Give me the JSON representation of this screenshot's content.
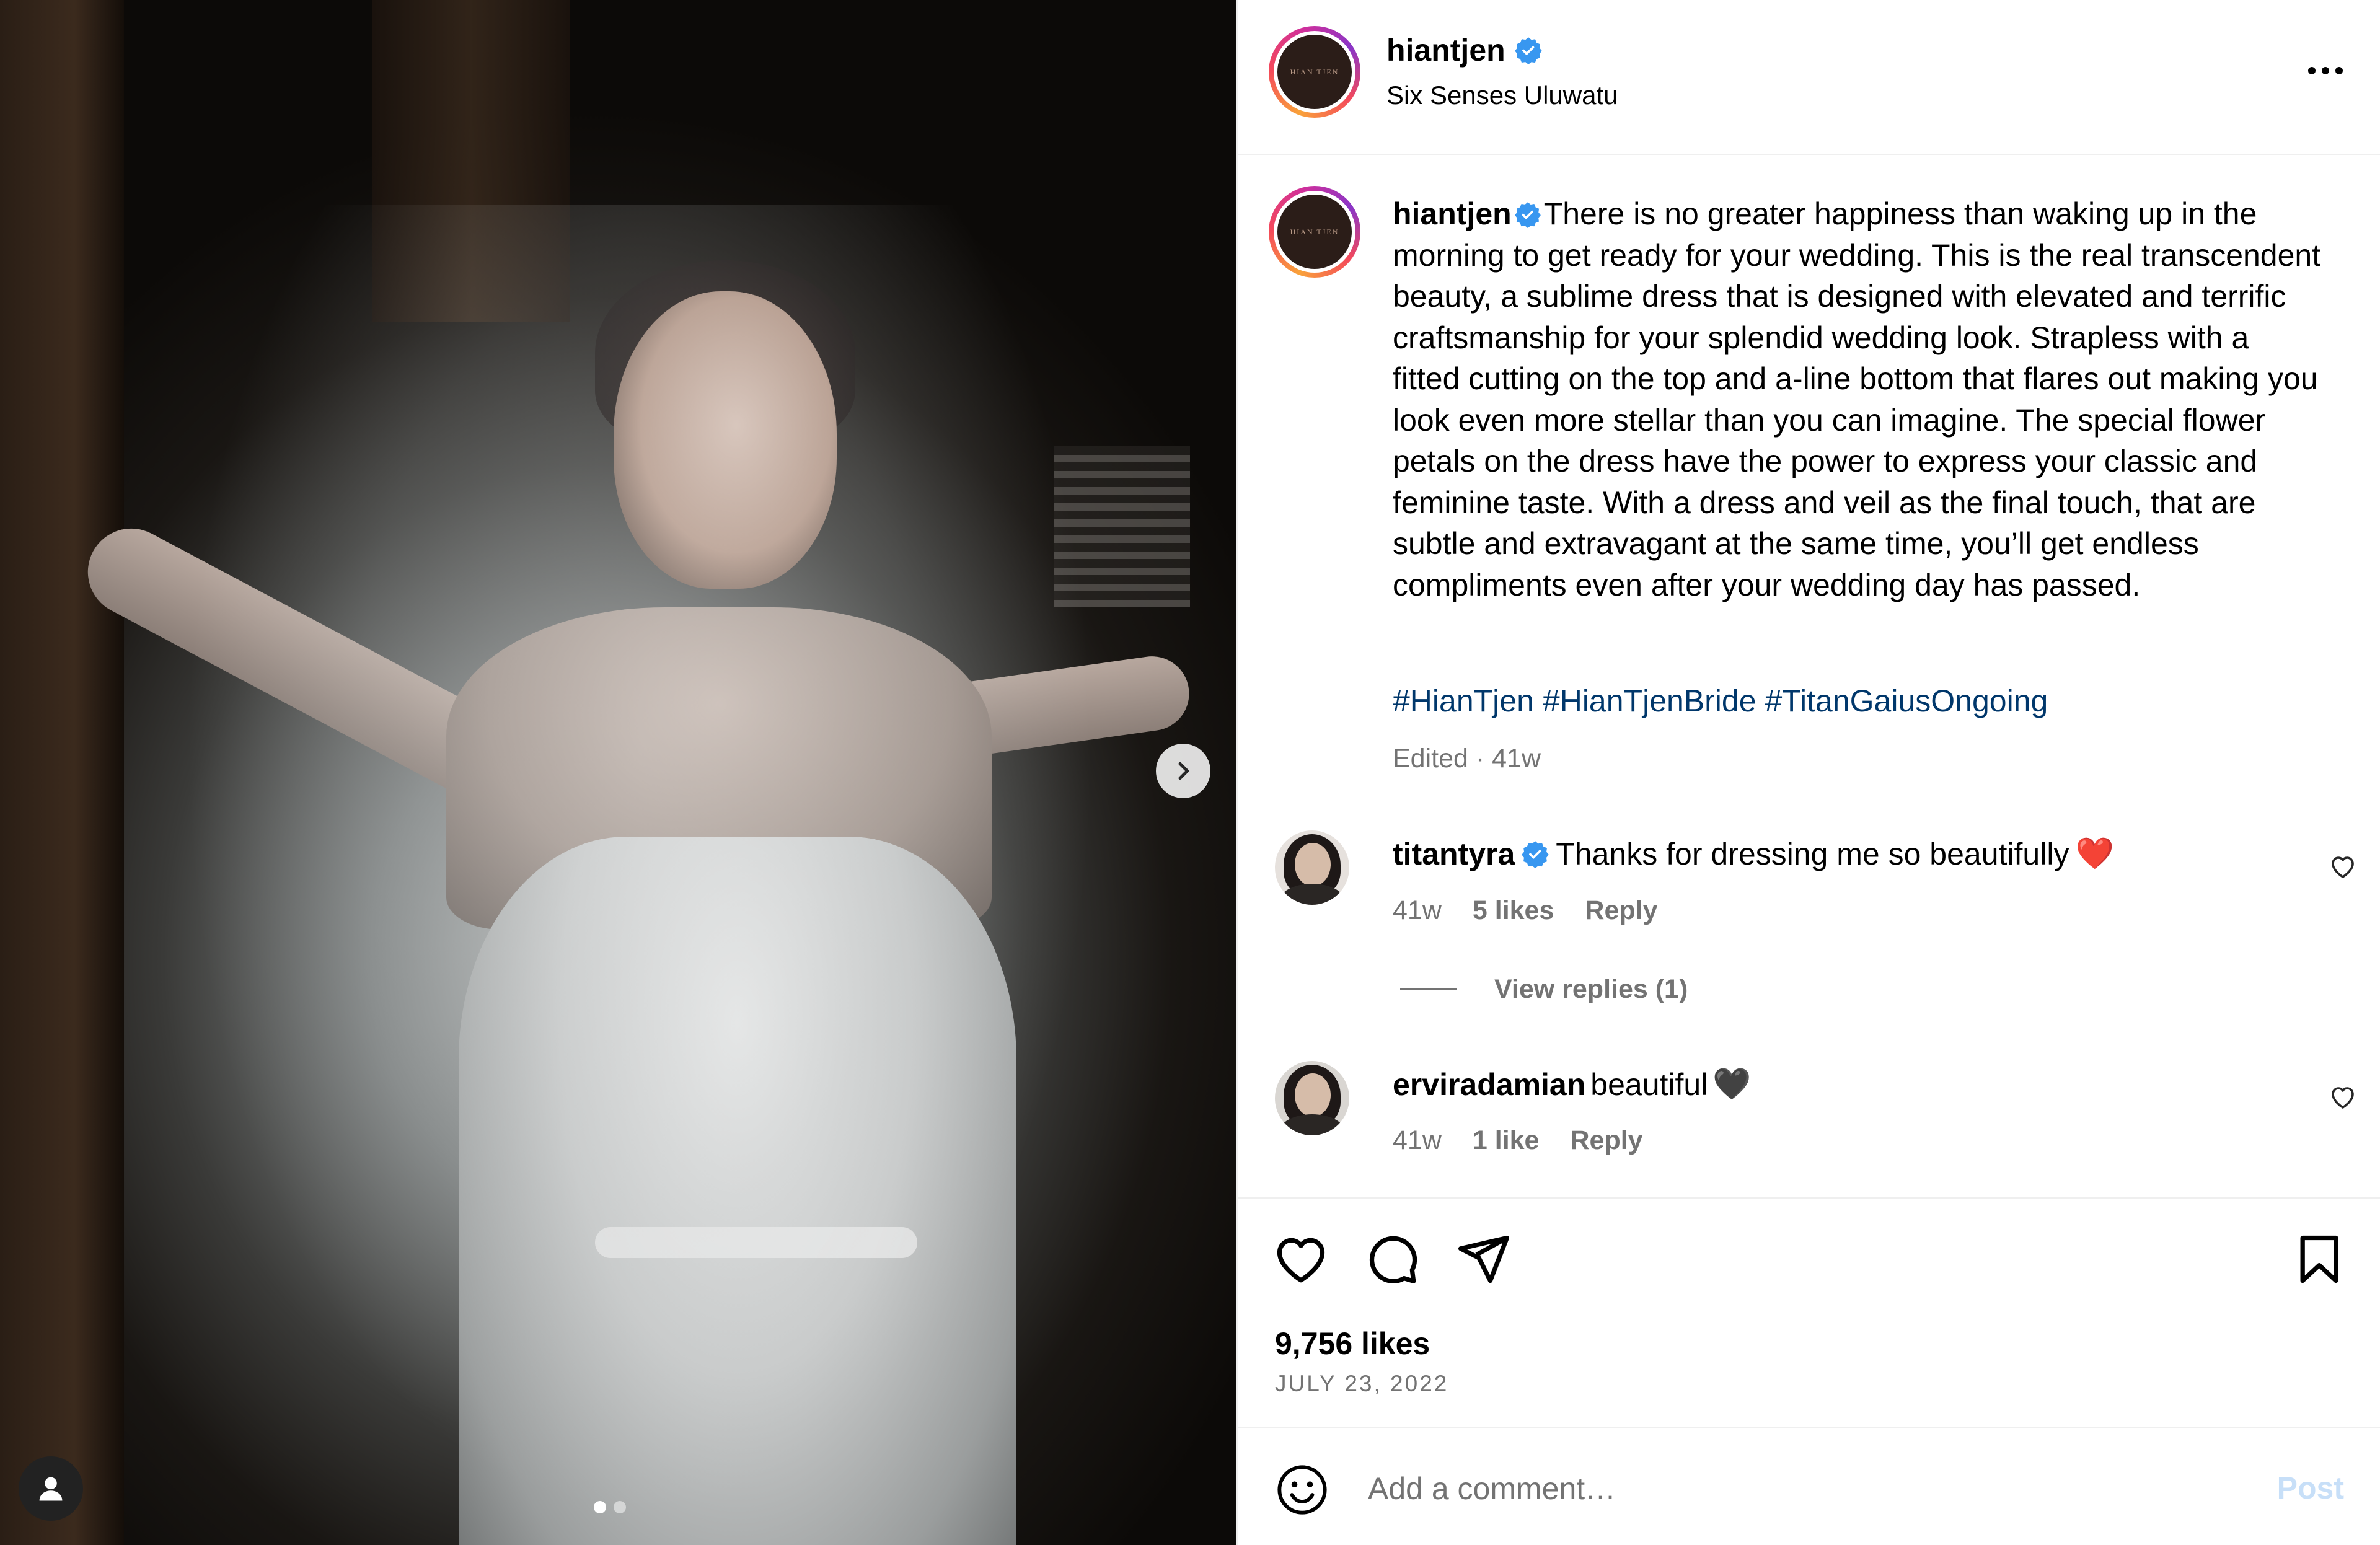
{
  "post": {
    "username": "hiantjen",
    "location": "Six Senses Uluwatu",
    "avatar_text": "HIAN TJEN",
    "more_icon": "more-icon",
    "caption": "There is no greater happiness than waking up in the morning to get ready for your wedding. This is the real transcendent beauty, a sublime dress that is designed with elevated and terrific craftsmanship for your splendid wedding look. Strapless with a fitted cutting on the top and a-line bottom that flares out making you look even more stellar than you can imagine. The special flower petals on the dress have the power to express your classic and feminine taste. With a dress and veil as the final touch, that are subtle and extravagant at the same time, you’ll get endless compliments even after your wedding day has passed.",
    "hashtags": [
      "#HianTjen",
      "#HianTjenBride",
      "#TitanGaiusOngoing"
    ],
    "edited": "Edited · 41w",
    "likes": "9,756 likes",
    "date": "JULY 23, 2022"
  },
  "comments": [
    {
      "username": "titantyra",
      "text": "Thanks for dressing me so beautifully",
      "emoji": "❤️",
      "time": "41w",
      "likes": "5 likes",
      "reply": "Reply",
      "view_replies": "View replies (1)"
    },
    {
      "username": "erviradamian",
      "text": "beautiful",
      "emoji": "🖤",
      "time": "41w",
      "likes": "1 like",
      "reply": "Reply"
    }
  ],
  "composer": {
    "placeholder": "Add a comment…",
    "post_label": "Post"
  },
  "carousel": {
    "slide_count": 2,
    "active_index": 0
  },
  "colors": {
    "link": "#00376b",
    "muted": "#737373",
    "verified": "#3897f0",
    "post_disabled": "#c7dff8",
    "heart_red": "#e02424"
  }
}
